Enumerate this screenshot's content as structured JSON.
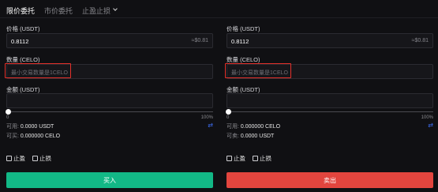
{
  "tabs": [
    {
      "label": "限价委托",
      "active": true
    },
    {
      "label": "市价委托",
      "active": false
    },
    {
      "label": "止盈止损",
      "active": false
    }
  ],
  "buy": {
    "price_label": "价格 (USDT)",
    "price_value": "0.8112",
    "price_approx": "≈$0.81",
    "qty_label": "数量 (CELO)",
    "qty_placeholder": "最小交易数量是1CELO",
    "amount_label": "金额 (USDT)",
    "slider_min": "0",
    "slider_max": "100%",
    "slider_percent": 0,
    "available_label": "可用:",
    "available_value": "0.0000 USDT",
    "buyable_label": "可买:",
    "buyable_value": "0.000000 CELO",
    "take_profit_label": "止盈",
    "stop_loss_label": "止损",
    "button_label": "买入"
  },
  "sell": {
    "price_label": "价格 (USDT)",
    "price_value": "0.8112",
    "price_approx": "≈$0.81",
    "qty_label": "数量 (CELO)",
    "qty_placeholder": "最小交易数量是1CELO",
    "amount_label": "金额 (USDT)",
    "slider_min": "0",
    "slider_max": "100%",
    "slider_percent": 0,
    "available_label": "可用:",
    "available_value": "0.000000 CELO",
    "sellable_label": "可卖:",
    "sellable_value": "0.0000 USDT",
    "take_profit_label": "止盈",
    "stop_loss_label": "止损",
    "button_label": "卖出"
  },
  "icons": {
    "dropdown": "chevron-down-icon",
    "swap": "swap-arrows-icon",
    "swap_glyph": "⇄"
  },
  "colors": {
    "buy": "#12b886",
    "sell": "#e2453e",
    "highlight": "#e3302a",
    "link": "#3d6df2"
  }
}
